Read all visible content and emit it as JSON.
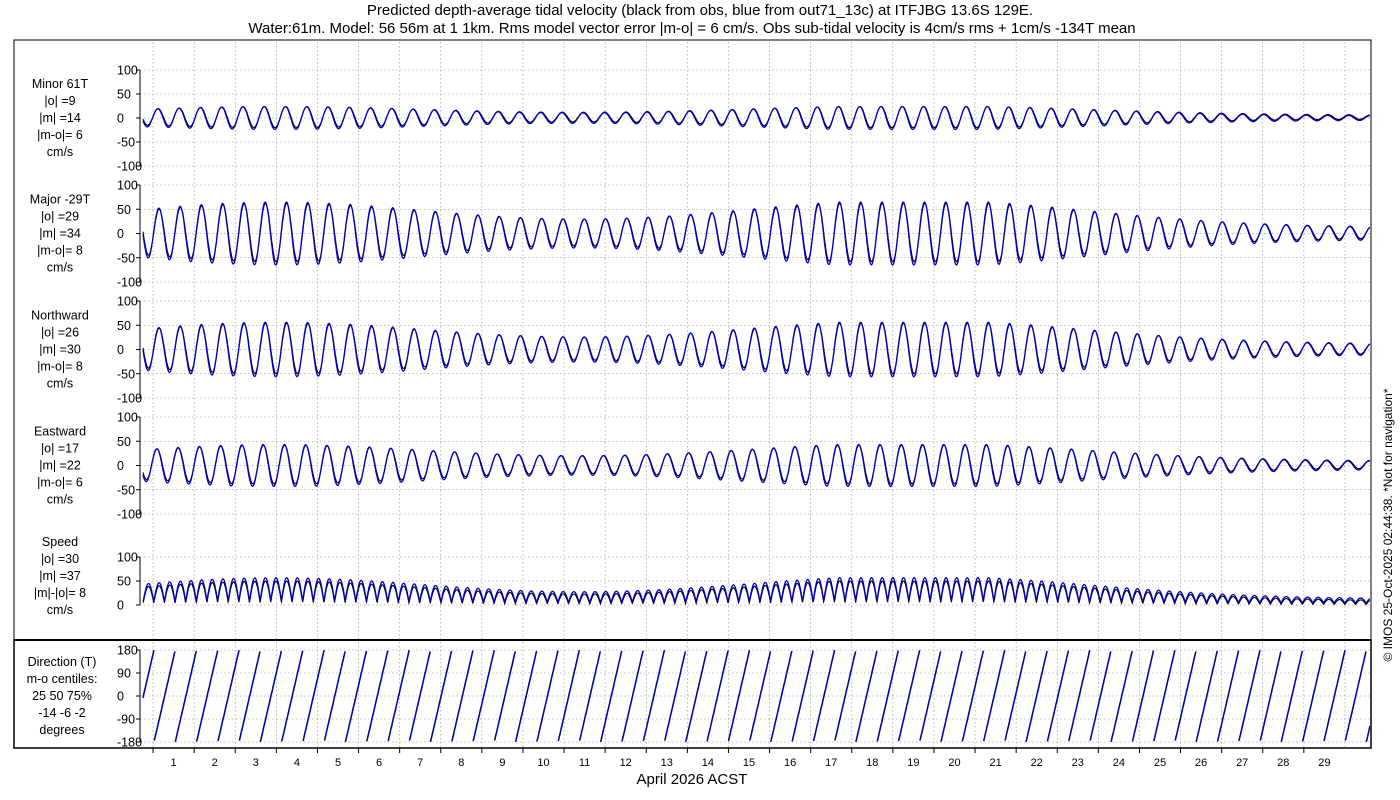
{
  "title_line1": "Predicted depth-average tidal velocity (black from obs, blue from out71_13c) at ITFJBG 13.6S 129E.",
  "title_line2": "Water:61m. Model: 56 56m at 1 1km. Rms model vector error |m-o| = 6 cm/s. Obs sub-tidal velocity is 4cm/s rms + 1cm/s -134T mean",
  "xlabel": "April 2026 ACST",
  "credit": "© IMOS 25-Oct-2025 02:44:38. *Not for navigation*",
  "colors": {
    "obs": "#000000",
    "model": "#0000c8",
    "grid": "#888888"
  },
  "chart_data": {
    "type": "line",
    "x_ticks": [
      "1",
      "2",
      "3",
      "4",
      "5",
      "6",
      "7",
      "8",
      "9",
      "10",
      "11",
      "12",
      "13",
      "14",
      "15",
      "16",
      "17",
      "18",
      "19",
      "20",
      "21",
      "22",
      "23",
      "24",
      "25",
      "26",
      "27",
      "28",
      "29"
    ],
    "x_range_days": [
      0.05,
      30.0
    ],
    "series_names": [
      "obs",
      "model"
    ],
    "tide": {
      "semidiurnal_period_hours": 12.42,
      "spring_centers_day": [
        3.5,
        19.0
      ],
      "neap_center_day": 11.0
    },
    "panels": [
      {
        "id": "minor",
        "label": [
          "Minor 61T",
          "|o| =9",
          "|m| =14",
          "|m-o|= 6",
          "cm/s"
        ],
        "yticks": [
          "100",
          "50",
          "0",
          "-50",
          "-100"
        ],
        "ylim": [
          -100,
          100
        ],
        "amplitude": 22
      },
      {
        "id": "major",
        "label": [
          "Major -29T",
          "|o| =29",
          "|m| =34",
          "|m-o|= 8",
          "cm/s"
        ],
        "yticks": [
          "100",
          "50",
          "0",
          "-50",
          "-100"
        ],
        "ylim": [
          -100,
          100
        ],
        "amplitude": 60
      },
      {
        "id": "north",
        "label": [
          "Northward",
          "|o| =26",
          "|m| =30",
          "|m-o|= 8",
          "cm/s"
        ],
        "yticks": [
          "100",
          "50",
          "0",
          "-50",
          "-100"
        ],
        "ylim": [
          -100,
          100
        ],
        "amplitude": 52
      },
      {
        "id": "east",
        "label": [
          "Eastward",
          "|o| =17",
          "|m| =22",
          "|m-o|= 6",
          "cm/s"
        ],
        "yticks": [
          "100",
          "50",
          "0",
          "-50",
          "-100"
        ],
        "ylim": [
          -100,
          100
        ],
        "amplitude": 40
      },
      {
        "id": "speed",
        "label": [
          "Speed",
          "|o| =30",
          "|m| =37",
          "|m|-|o|= 8",
          "cm/s"
        ],
        "yticks": [
          "100",
          "50",
          "0"
        ],
        "ylim": [
          0,
          100
        ],
        "amplitude": 60
      },
      {
        "id": "direction",
        "label": [
          "Direction (T)",
          "m-o centiles:",
          "25  50  75%",
          "-14  -6  -2",
          "degrees"
        ],
        "yticks": [
          "180",
          "90",
          "0",
          "-90",
          "-180"
        ],
        "ylim": [
          -180,
          180
        ],
        "amplitude": 180
      }
    ]
  }
}
